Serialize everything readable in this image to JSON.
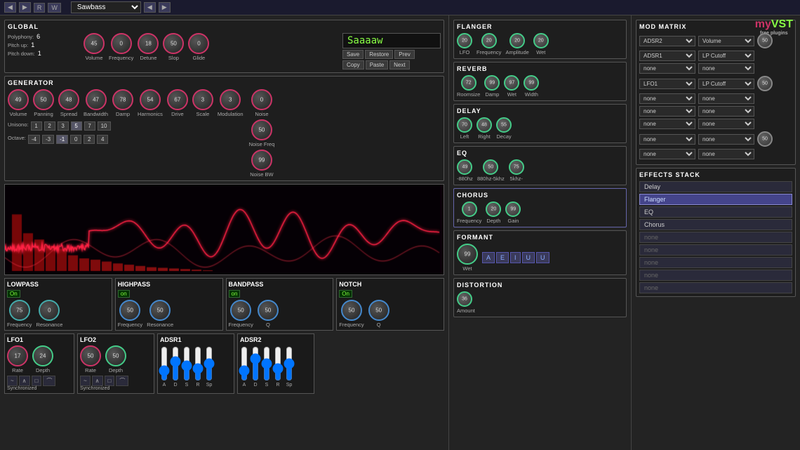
{
  "topbar": {
    "buttons": [
      "◀",
      "▶",
      "R",
      "W"
    ],
    "preset_name": "Sawbass",
    "arrows": [
      "◀",
      "▶"
    ]
  },
  "global": {
    "title": "GLOBAL",
    "polyphony_label": "Polyphony:",
    "polyphony_value": "6",
    "pitch_up_label": "Pitch up:",
    "pitch_up_value": "1",
    "pitch_down_label": "Pitch down:",
    "pitch_down_value": "1",
    "knobs": [
      {
        "label": "Volume",
        "value": "45",
        "ring": "pink"
      },
      {
        "label": "Frequency",
        "value": "0",
        "ring": "pink"
      },
      {
        "label": "Detune",
        "value": "18",
        "ring": "pink"
      },
      {
        "label": "Slop",
        "value": "50",
        "ring": "pink"
      },
      {
        "label": "Glide",
        "value": "0",
        "ring": "pink"
      }
    ],
    "preset_display": "Saaaaw",
    "preset_buttons": [
      "Save",
      "Restore",
      "Prev",
      "Copy",
      "Paste",
      "Next"
    ]
  },
  "generator": {
    "title": "GENERATOR",
    "knobs": [
      {
        "label": "Volume",
        "value": "49",
        "ring": "pink"
      },
      {
        "label": "Panning",
        "value": "50",
        "ring": "pink"
      },
      {
        "label": "Spread",
        "value": "48",
        "ring": "pink"
      },
      {
        "label": "Bandwidth",
        "value": "47",
        "ring": "pink"
      },
      {
        "label": "Damp",
        "value": "78",
        "ring": "pink"
      },
      {
        "label": "Harmonics",
        "value": "54",
        "ring": "pink"
      },
      {
        "label": "Drive",
        "value": "67",
        "ring": "pink"
      },
      {
        "label": "Scale",
        "value": "3",
        "ring": "pink"
      },
      {
        "label": "Modulation",
        "value": "3",
        "ring": "pink"
      }
    ],
    "unisono_label": "Unisono:",
    "unisono_values": [
      "1",
      "2",
      "3",
      "5",
      "7",
      "10"
    ],
    "octave_label": "Octave:",
    "octave_values": [
      "-4",
      "-3",
      "-1",
      "0",
      "2",
      "4"
    ],
    "noise_knobs": [
      {
        "label": "Noise",
        "value": "0",
        "ring": "pink"
      },
      {
        "label": "Noise Freq",
        "value": "50",
        "ring": "pink"
      },
      {
        "label": "Noise BW",
        "value": "99",
        "ring": "pink"
      }
    ]
  },
  "lowpass": {
    "title": "LOWPASS",
    "status": "On",
    "knobs": [
      {
        "label": "Frequency",
        "value": "75",
        "ring": "teal"
      },
      {
        "label": "Resonance",
        "value": "0",
        "ring": "teal"
      }
    ]
  },
  "highpass": {
    "title": "HIGHPASS",
    "status": "on",
    "knobs": [
      {
        "label": "Frequency",
        "value": "50",
        "ring": "blue"
      },
      {
        "label": "Resonance",
        "value": "50",
        "ring": "blue"
      }
    ]
  },
  "bandpass": {
    "title": "BANDPASS",
    "status": "on",
    "knobs": [
      {
        "label": "Frequency",
        "value": "50",
        "ring": "blue"
      },
      {
        "label": "Q",
        "value": "50",
        "ring": "blue"
      }
    ]
  },
  "notch": {
    "title": "NOTCH",
    "status": "On",
    "knobs": [
      {
        "label": "Frequency",
        "value": "50",
        "ring": "blue"
      },
      {
        "label": "Q",
        "value": "50",
        "ring": "blue"
      }
    ]
  },
  "lfo1": {
    "title": "LFO1",
    "knobs": [
      {
        "label": "Rate",
        "value": "17",
        "ring": "pink"
      },
      {
        "label": "Depth",
        "value": "24",
        "ring": "green"
      }
    ],
    "sync_label": "Synchronized",
    "wave_shapes": [
      "~",
      "∧",
      "□",
      "⌒"
    ]
  },
  "lfo2": {
    "title": "LFO2",
    "knobs": [
      {
        "label": "Rate",
        "value": "50",
        "ring": "pink"
      },
      {
        "label": "Depth",
        "value": "50",
        "ring": "green"
      }
    ],
    "sync_label": "Synchronized",
    "wave_shapes": [
      "~",
      "∧",
      "□",
      "⌒"
    ]
  },
  "adsr1": {
    "title": "ADSR1",
    "sliders": [
      {
        "label": "A"
      },
      {
        "label": "D"
      },
      {
        "label": "S"
      },
      {
        "label": "R"
      },
      {
        "label": "Sp"
      }
    ],
    "sync_label": ""
  },
  "adsr2": {
    "title": "ADSR2",
    "sliders": [
      {
        "label": "A"
      },
      {
        "label": "D"
      },
      {
        "label": "S"
      },
      {
        "label": "R"
      },
      {
        "label": "Sp"
      }
    ]
  },
  "flanger": {
    "title": "FLANGER",
    "knobs": [
      {
        "label": "LFO",
        "value": "20",
        "ring": "green"
      },
      {
        "label": "Frequency",
        "value": "20",
        "ring": "green"
      },
      {
        "label": "Amplitude",
        "value": "20",
        "ring": "green"
      },
      {
        "label": "Wet",
        "value": "20",
        "ring": "green"
      }
    ]
  },
  "reverb": {
    "title": "REVERB",
    "knobs": [
      {
        "label": "Roomsize",
        "value": "72",
        "ring": "green"
      },
      {
        "label": "Damp",
        "value": "99",
        "ring": "green"
      },
      {
        "label": "Wet",
        "value": "97",
        "ring": "green"
      },
      {
        "label": "Width",
        "value": "99",
        "ring": "green"
      }
    ]
  },
  "delay": {
    "title": "DELAY",
    "knobs": [
      {
        "label": "Left",
        "value": "70",
        "ring": "green"
      },
      {
        "label": "Right",
        "value": "48",
        "ring": "green"
      },
      {
        "label": "Decay",
        "value": "55",
        "ring": "green"
      }
    ]
  },
  "eq": {
    "title": "EQ",
    "knobs": [
      {
        "label": "-880hz",
        "value": "49",
        "ring": "green"
      },
      {
        "label": "880hz-5khz",
        "value": "50",
        "ring": "green"
      },
      {
        "label": "5khz-",
        "value": "75",
        "ring": "green"
      }
    ]
  },
  "chorus": {
    "title": "CHORUS",
    "knobs": [
      {
        "label": "Frequency",
        "value": "1",
        "ring": "green"
      },
      {
        "label": "Depth",
        "value": "20",
        "ring": "green"
      },
      {
        "label": "Gain",
        "value": "99",
        "ring": "green"
      }
    ]
  },
  "formant": {
    "title": "FORMANT",
    "knobs": [
      {
        "label": "Wet",
        "value": "99",
        "ring": "green"
      }
    ],
    "buttons": [
      "A",
      "E",
      "I",
      "U",
      "U"
    ]
  },
  "distortion": {
    "title": "DISTORTION",
    "knobs": [
      {
        "label": "Amount",
        "value": "36",
        "ring": "green"
      }
    ]
  },
  "mod_matrix": {
    "title": "MOD MATRIX",
    "rows": [
      {
        "source": "ADSR2",
        "dest": "Volume"
      },
      {
        "source": "ADSR1",
        "dest": "LP Cutoff"
      },
      {
        "source": "none",
        "dest": "none"
      },
      {
        "source": "LFO1",
        "dest": "LP Cutoff"
      },
      {
        "source": "none",
        "dest": "none"
      },
      {
        "source": "none",
        "dest": "none"
      },
      {
        "source": "none",
        "dest": "none"
      },
      {
        "source": "none",
        "dest": "none"
      },
      {
        "source": "none",
        "dest": "none"
      }
    ]
  },
  "effects_stack": {
    "title": "EFFECTS STACK",
    "items": [
      "Delay",
      "Flanger",
      "EQ",
      "Chorus",
      "none",
      "none",
      "none",
      "none",
      "none"
    ]
  },
  "myvst": {
    "my": "my",
    "vst": "VST",
    "sub": "free plugins"
  }
}
